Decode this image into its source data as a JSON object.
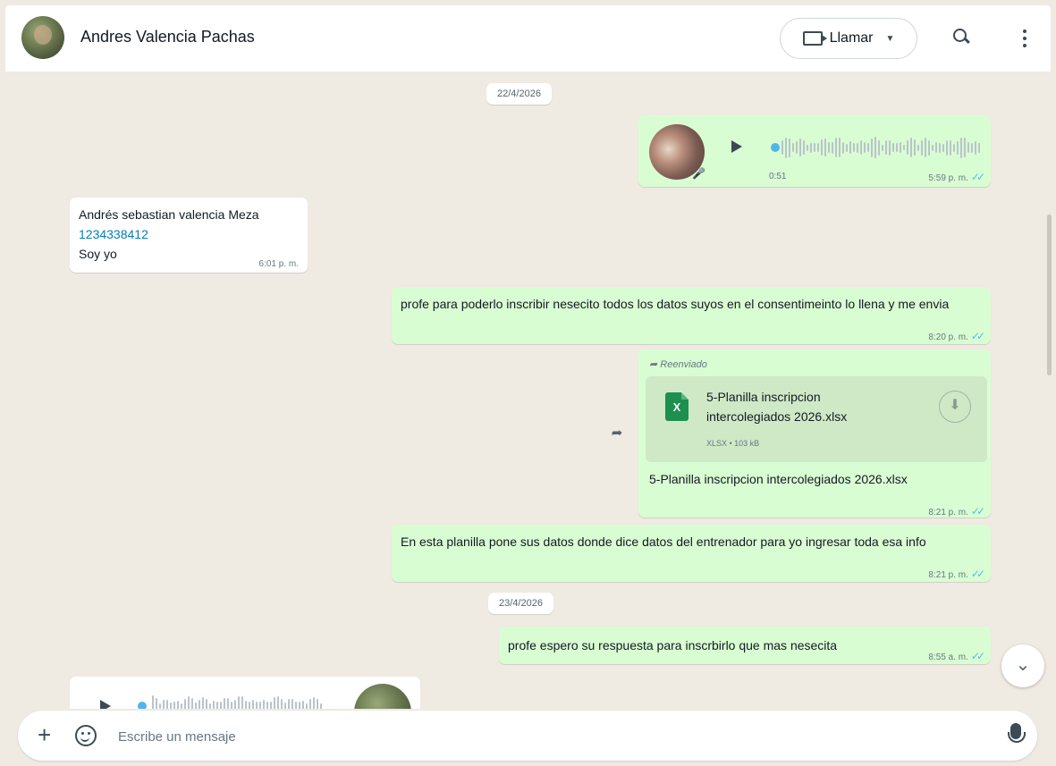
{
  "header": {
    "contact_name": "Andres Valencia Pachas",
    "call_label": "Llamar"
  },
  "chat": {
    "dates": [
      "22/4/2026",
      "23/4/2026"
    ],
    "messages": [
      {
        "type": "voice",
        "direction": "out",
        "duration": "0:51",
        "time": "5:59 p. m."
      },
      {
        "type": "text",
        "direction": "in",
        "lines": [
          "Andrés sebastian valencia Meza",
          "1234338412",
          "Soy yo"
        ],
        "time": "6:01 p. m."
      },
      {
        "type": "text",
        "direction": "out",
        "text": "profe para poderlo inscribir nesecito  todos los datos suyos en el consentimeinto lo llena y me envia",
        "time": "8:20 p. m."
      },
      {
        "type": "document",
        "direction": "out",
        "forwarded_label": "Reenviado",
        "file_name": "5-Planilla inscripcion intercolegiados 2026.xlsx",
        "file_meta": "XLSX • 103 kB",
        "caption": "5-Planilla inscripcion intercolegiados 2026.xlsx",
        "time": "8:21 p. m."
      },
      {
        "type": "text",
        "direction": "out",
        "text": "En esta planilla pone sus datos donde dice datos del entrenador para yo ingresar toda esa info",
        "time": "8:21 p. m."
      },
      {
        "type": "text",
        "direction": "out",
        "text": "profe espero su respuesta para inscrbirlo  que mas nesecita",
        "time": "8:55 a. m."
      }
    ]
  },
  "composer": {
    "placeholder": "Escribe un mensaje"
  },
  "icons": {
    "search": "search-icon",
    "menu": "kebab-menu-icon",
    "video": "video-camera-icon",
    "plus": "plus-icon",
    "sticker": "sticker-icon",
    "mic": "microphone-icon",
    "scroll_down": "chevron-down-icon",
    "download": "download-icon",
    "share": "forward-icon"
  },
  "colors": {
    "outgoing_bubble": "#d9fdd3",
    "incoming_bubble": "#ffffff",
    "read_ticks": "#53bdeb",
    "phone_link": "#027eb5",
    "chat_background": "#efeae2"
  }
}
